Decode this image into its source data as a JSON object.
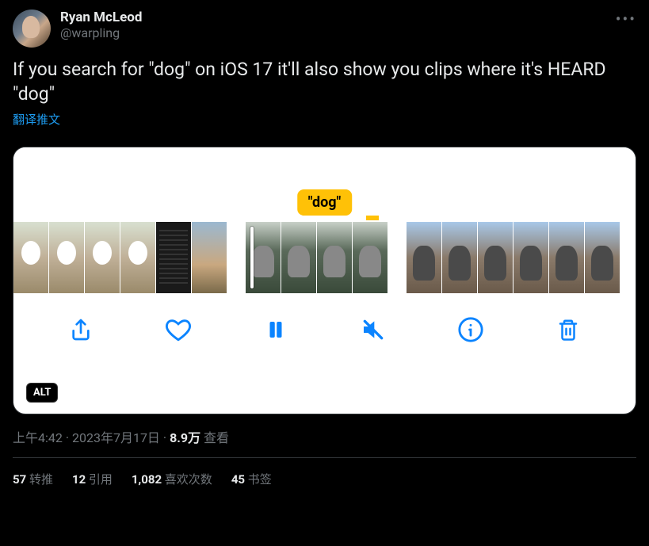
{
  "user": {
    "display_name": "Ryan McLeod",
    "handle": "@warpling"
  },
  "tweet_text": "If you search for \"dog\" on iOS 17 it'll also show you clips where it's HEARD \"dog\"",
  "translate_label": "翻译推文",
  "media": {
    "search_tag": "\"dog\"",
    "alt_badge": "ALT"
  },
  "meta": {
    "time": "上午4:42",
    "date": "2023年7月17日",
    "views_count": "8.9万",
    "views_label": "查看"
  },
  "stats": {
    "retweets_count": "57",
    "retweets_label": "转推",
    "quotes_count": "12",
    "quotes_label": "引用",
    "likes_count": "1,082",
    "likes_label": "喜欢次数",
    "bookmarks_count": "45",
    "bookmarks_label": "书签"
  }
}
